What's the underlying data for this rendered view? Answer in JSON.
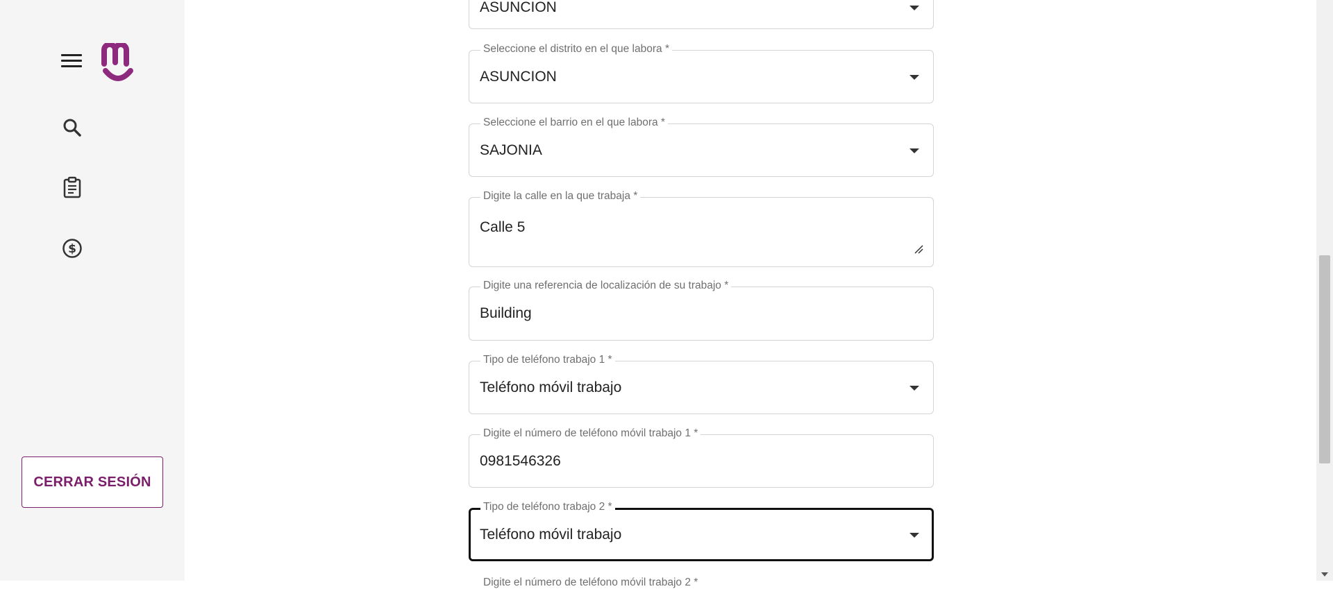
{
  "sidebar": {
    "menu_icon": "hamburger-menu-icon",
    "logo_icon": "brand-logo-icon",
    "nav": [
      {
        "icon": "search-icon"
      },
      {
        "icon": "clipboard-icon"
      },
      {
        "icon": "dollar-circle-icon"
      }
    ],
    "logout_label": "CERRAR SESIÓN"
  },
  "colors": {
    "brand": "#8e2a7e",
    "logout_text": "#7b1e6a",
    "sidebar_bg": "#f5f5f5",
    "focused_border": "#111111"
  },
  "form": {
    "fields": [
      {
        "label": "",
        "value": "ASUNCION",
        "type": "select"
      },
      {
        "label": "Seleccione el distrito en el que labora *",
        "value": "ASUNCION",
        "type": "select"
      },
      {
        "label": "Seleccione el barrio en el que labora *",
        "value": "SAJONIA",
        "type": "select"
      },
      {
        "label": "Digite la calle en la que trabaja *",
        "value": "Calle 5",
        "type": "textarea"
      },
      {
        "label": "Digite una referencia de localización de su trabajo *",
        "value": "Building",
        "type": "text"
      },
      {
        "label": "Tipo de teléfono trabajo 1 *",
        "value": "Teléfono móvil trabajo",
        "type": "select"
      },
      {
        "label": "Digite el número de teléfono móvil trabajo 1 *",
        "value": "0981546326",
        "type": "text"
      },
      {
        "label": "Tipo de teléfono trabajo 2 *",
        "value": "Teléfono móvil trabajo",
        "type": "select",
        "focused": true
      }
    ],
    "next_field_label": "Digite el número de teléfono móvil trabajo 2 *"
  }
}
